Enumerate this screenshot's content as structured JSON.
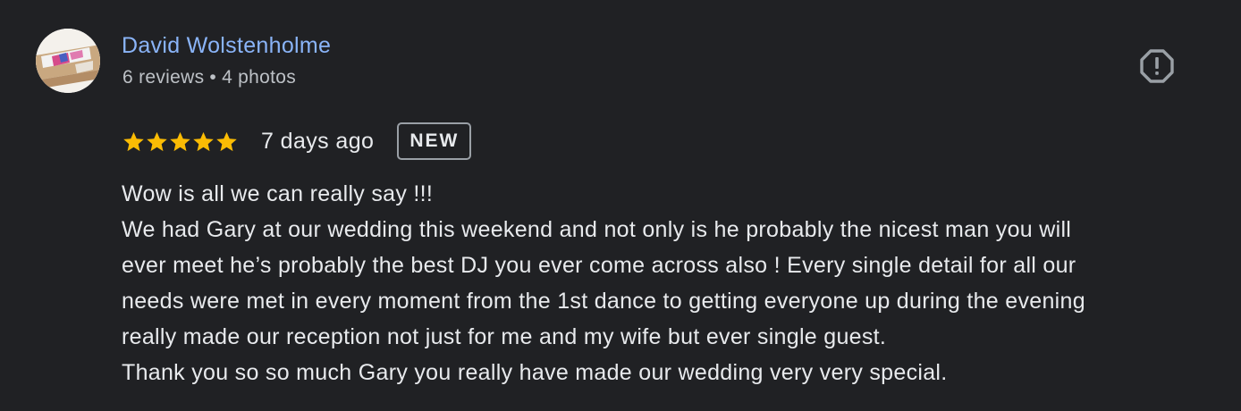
{
  "review": {
    "author": {
      "name": "David Wolstenholme",
      "reviews": "6 reviews",
      "separator": "•",
      "photos": "4 photos"
    },
    "rating": 5,
    "rating_max": 5,
    "date": "7 days ago",
    "badge": "NEW",
    "text_lines": [
      "Wow is all we can really say !!!",
      "We had Gary at our wedding this weekend and not only is he probably the nicest man you will",
      "ever meet he’s probably the best DJ you ever come across also ! Every single detail for all our",
      "needs were met in every moment from the 1st dance to getting everyone up during the evening",
      "really made our reception not just for me and my wife but ever single guest.",
      "Thank you so so much Gary you really have made our wedding very very special."
    ],
    "icons": {
      "report": "report-flag-icon",
      "star": "star-icon"
    }
  },
  "colors": {
    "background": "#202124",
    "author_link": "#8ab4f8",
    "star": "#fbbc04",
    "secondary_text": "#bdc1c6",
    "primary_text": "#e8eaed",
    "report_icon": "#9aa0a6"
  }
}
